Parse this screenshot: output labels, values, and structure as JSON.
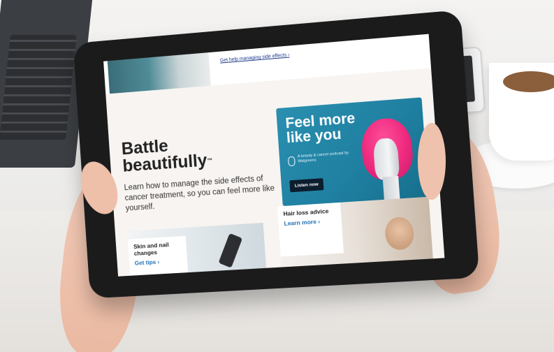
{
  "tablet_page": {
    "top_link": "Get help managing side effects ›",
    "hero": {
      "title_line1": "Battle",
      "title_line2": "beautifully",
      "trademark": "™",
      "description": "Learn how to manage the side effects of cancer treatment, so you can feel more like yourself."
    },
    "promo": {
      "title": "Feel more like you",
      "subtitle": "A beauty & cancer podcast by Walgreens",
      "button": "Listen now"
    },
    "cards": [
      {
        "title": "Skin and nail changes",
        "link": "Get tips ›"
      },
      {
        "title": "Hair loss advice",
        "link": "Learn more ›"
      }
    ]
  },
  "colors": {
    "page_background": "#f7f4f1",
    "promo_background": "#2a8fb0",
    "button_dark": "#0c1d2e",
    "link_blue": "#1f6fb5",
    "wig_pink": "#ef2a7f"
  }
}
